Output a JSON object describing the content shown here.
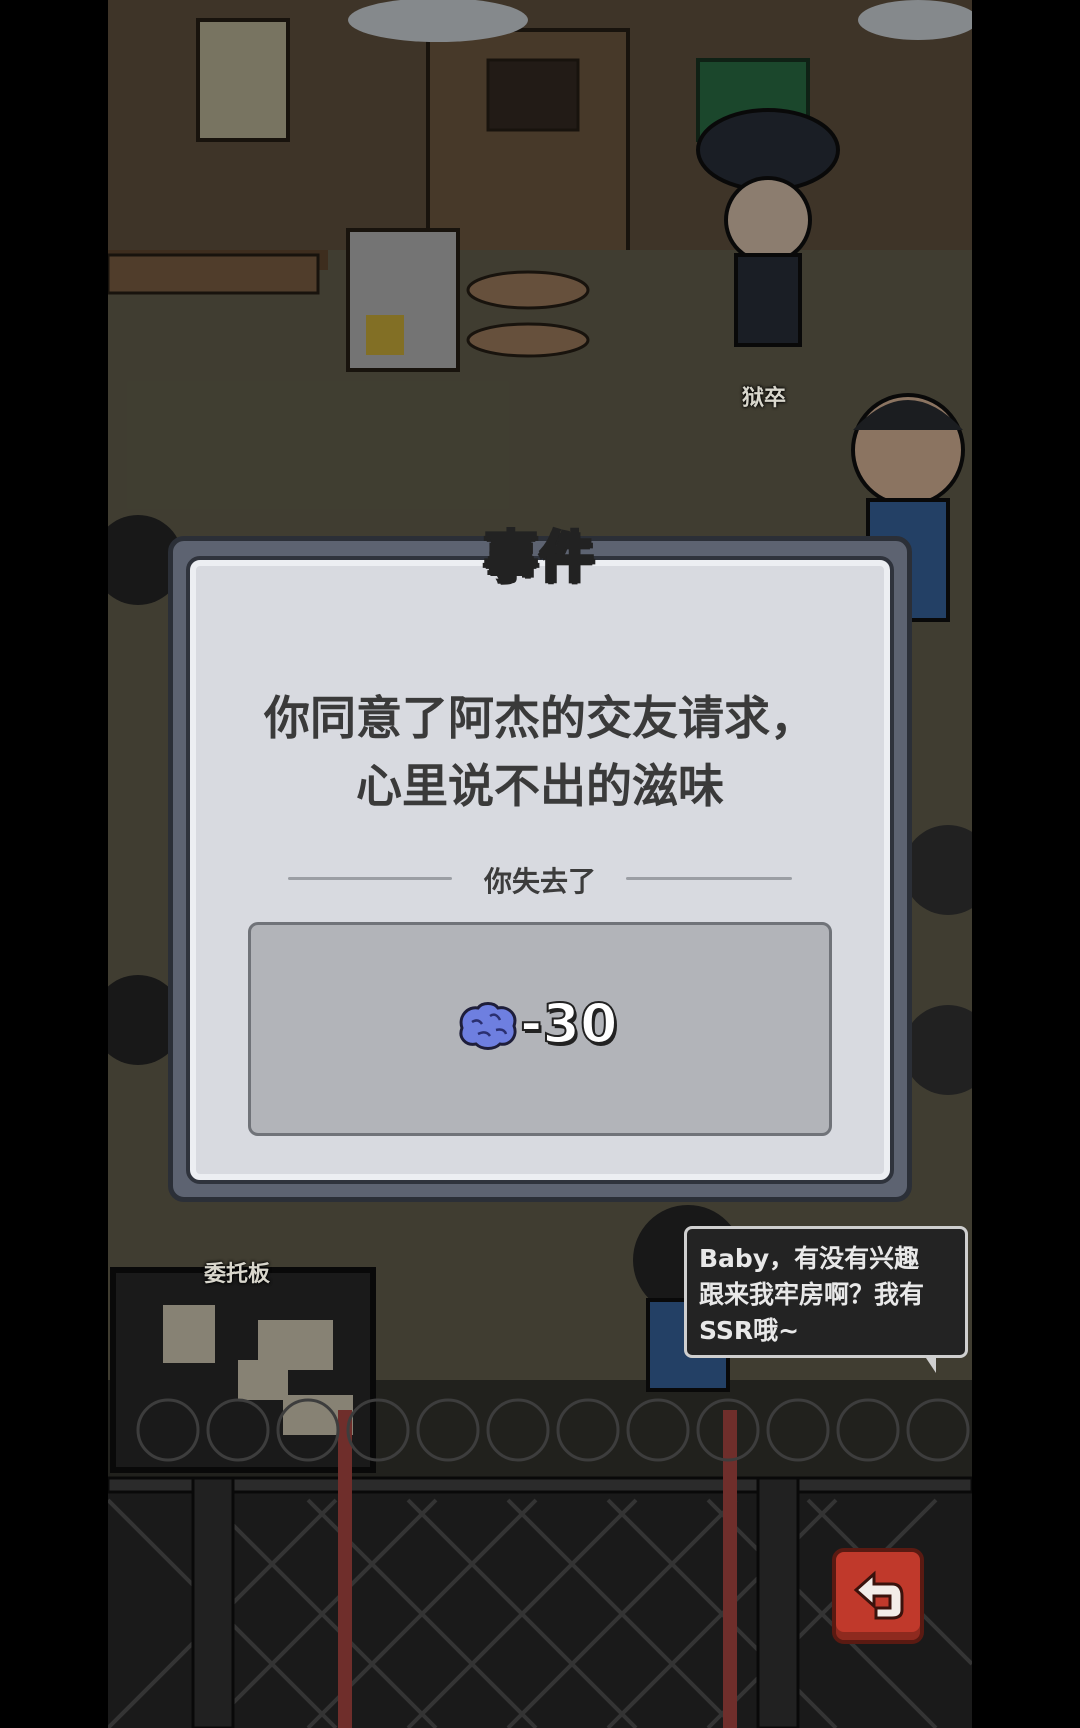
{
  "scene": {
    "guard_label": "狱卒",
    "board_label": "委托板"
  },
  "modal": {
    "title": "事件",
    "message_lines": [
      "你同意了阿杰的交友请求，",
      "心里说不出的滋味"
    ],
    "lost_label": "你失去了",
    "reward": {
      "icon": "brain-icon",
      "value": "-30"
    }
  },
  "speech_bubble": {
    "lines": [
      "Baby，有没有兴趣",
      "跟来我牢房啊？我有",
      "SSR哦~"
    ]
  },
  "buttons": {
    "back_icon": "return-arrow-icon"
  },
  "colors": {
    "back_button": "#c0392b",
    "brain": "#6e7fe0",
    "modal_bg": "#d8dae0"
  }
}
